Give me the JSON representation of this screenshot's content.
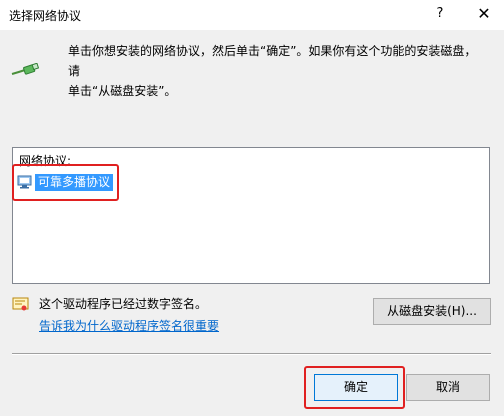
{
  "window": {
    "title": "选择网络协议",
    "help_label": "?",
    "close_label": "✕"
  },
  "instruction": {
    "icon": "network-cable-icon",
    "line1": "单击你想安装的网络协议，然后单击“确定”。如果你有这个功能的安装磁盘，请",
    "line2": "单击“从磁盘安装”。"
  },
  "protocol_list": {
    "header": "网络协议:",
    "items": [
      {
        "label": "可靠多播协议",
        "icon": "network-protocol-icon",
        "selected": true
      }
    ]
  },
  "driver_info": {
    "icon": "certificate-icon",
    "signed_text": "这个驱动程序已经过数字签名。",
    "link_text": "告诉我为什么驱动程序签名很重要"
  },
  "buttons": {
    "have_disk": "从磁盘安装(H)...",
    "ok": "确定",
    "cancel": "取消"
  },
  "colors": {
    "selection": "#3399ff",
    "highlight_box": "#e02020",
    "link": "#0066cc",
    "dialog_bg": "#f0f0f0"
  }
}
